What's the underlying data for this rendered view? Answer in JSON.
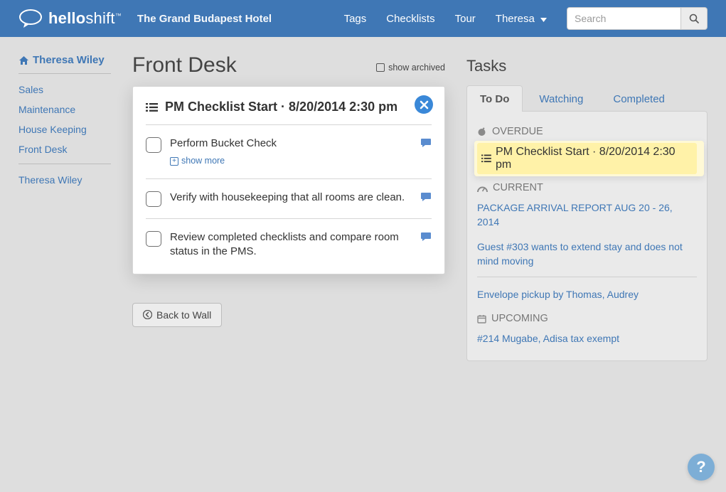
{
  "brand": {
    "name_bold": "hello",
    "name_light": "shift",
    "tm": "™"
  },
  "hotel_name": "The Grand Budapest Hotel",
  "nav": {
    "tags": "Tags",
    "checklists": "Checklists",
    "tour": "Tour",
    "user": "Theresa"
  },
  "search": {
    "placeholder": "Search"
  },
  "sidebar": {
    "profile": "Theresa Wiley",
    "links": [
      "Sales",
      "Maintenance",
      "House Keeping",
      "Front Desk"
    ],
    "user_link": "Theresa Wiley"
  },
  "main": {
    "title": "Front Desk",
    "show_archived": "show archived",
    "card_title": "PM Checklist Start · 8/20/2014 2:30 pm",
    "show_more": "show more",
    "items": [
      {
        "text": "Perform Bucket Check",
        "has_more": true
      },
      {
        "text": "Verify with housekeeping that all rooms are clean."
      },
      {
        "text": "Review completed checklists and compare room status in the PMS."
      }
    ],
    "back": "Back to Wall"
  },
  "tasks": {
    "title": "Tasks",
    "tabs": {
      "todo": "To Do",
      "watching": "Watching",
      "completed": "Completed"
    },
    "sections": {
      "overdue": {
        "label": "OVERDUE",
        "items": [
          {
            "text": "PM Checklist Start · 8/20/2014 2:30 pm",
            "highlight": true
          }
        ]
      },
      "current": {
        "label": "CURRENT",
        "items": [
          {
            "text": "PACKAGE ARRIVAL REPORT AUG 20 - 26, 2014"
          },
          {
            "text": "Guest #303 wants to extend stay and does not mind moving"
          },
          {
            "text": "Envelope pickup by Thomas, Audrey"
          }
        ]
      },
      "upcoming": {
        "label": "UPCOMING",
        "items": [
          {
            "text": "#214 Mugabe, Adisa tax exempt"
          }
        ]
      }
    }
  },
  "help": "?"
}
